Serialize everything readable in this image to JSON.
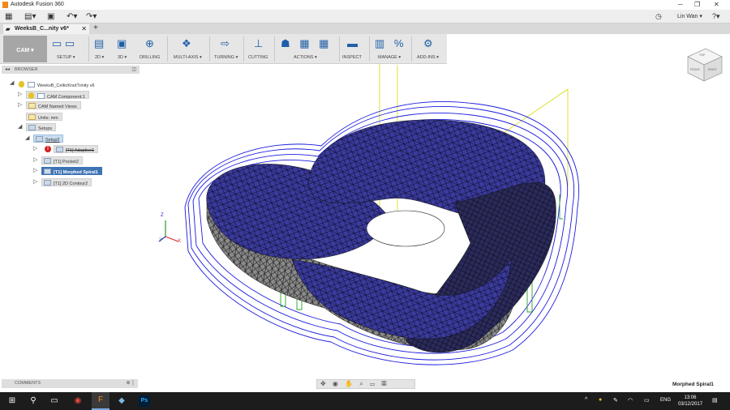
{
  "window": {
    "title": "Autodesk Fusion 360",
    "minimize": "─",
    "restore": "❐",
    "close": "✕"
  },
  "qat": {
    "user_name": "Lin Wan ▾",
    "help": "?▾",
    "clock_icon": "◷"
  },
  "tabs": {
    "doc_tab": "WeeksB_C...nity v6*",
    "new_tab": "+"
  },
  "toolbar": {
    "workspace": "CAM ▾",
    "groups": [
      {
        "label": "SETUP ▾",
        "icons": "▭ ▭"
      },
      {
        "label": "2D ▾",
        "icons": "▤"
      },
      {
        "label": "3D ▾",
        "icons": "▣"
      },
      {
        "label": "DRILLING",
        "icons": "⊕"
      },
      {
        "label": "MULTI-AXIS ▾",
        "icons": "❖"
      },
      {
        "label": "TURNING ▾",
        "icons": "⇨"
      },
      {
        "label": "CUTTING",
        "icons": "⊥"
      },
      {
        "label": "ACTIONS ▾",
        "icons": "☗ ▦ ▦"
      },
      {
        "label": "INSPECT",
        "icons": "▬"
      },
      {
        "label": "MANAGE ▾",
        "icons": "▥ %"
      },
      {
        "label": "ADD-INS ▾",
        "icons": "⚙"
      }
    ]
  },
  "browser": {
    "header": "BROWSER",
    "items": [
      {
        "label": "WeeksB_CelticKnotTrinity v6"
      },
      {
        "label": "CAM Component:1"
      },
      {
        "label": "CAM Named Views"
      },
      {
        "label": "Units: mm"
      },
      {
        "label": "Setups"
      },
      {
        "label": "Setup2"
      },
      {
        "label": "[T1] Adaptive1"
      },
      {
        "label": "[T1] Pocket2"
      },
      {
        "label": "[T1] Morphed Spiral1"
      },
      {
        "label": "[T1] 2D Contour2"
      }
    ]
  },
  "comments": {
    "label": "COMMENTS"
  },
  "navbar": {
    "icons": "✥ ◉ ✋ ⌕ ▭ ▦"
  },
  "status": {
    "current_operation": "Morphed Spiral1"
  },
  "viewcube": {
    "front": "FRONT",
    "right": "RIGHT",
    "top": "TOP"
  },
  "axes": {
    "x": "X",
    "y": "Y",
    "z": "Z"
  },
  "taskbar": {
    "time": "13:06",
    "date": "03/12/2017",
    "language": "ENG"
  },
  "colors": {
    "toolpath": "#1a1adf",
    "mesh": "#2a2a8a",
    "highlight": "#e6e600",
    "selected": "#3e73b4"
  }
}
